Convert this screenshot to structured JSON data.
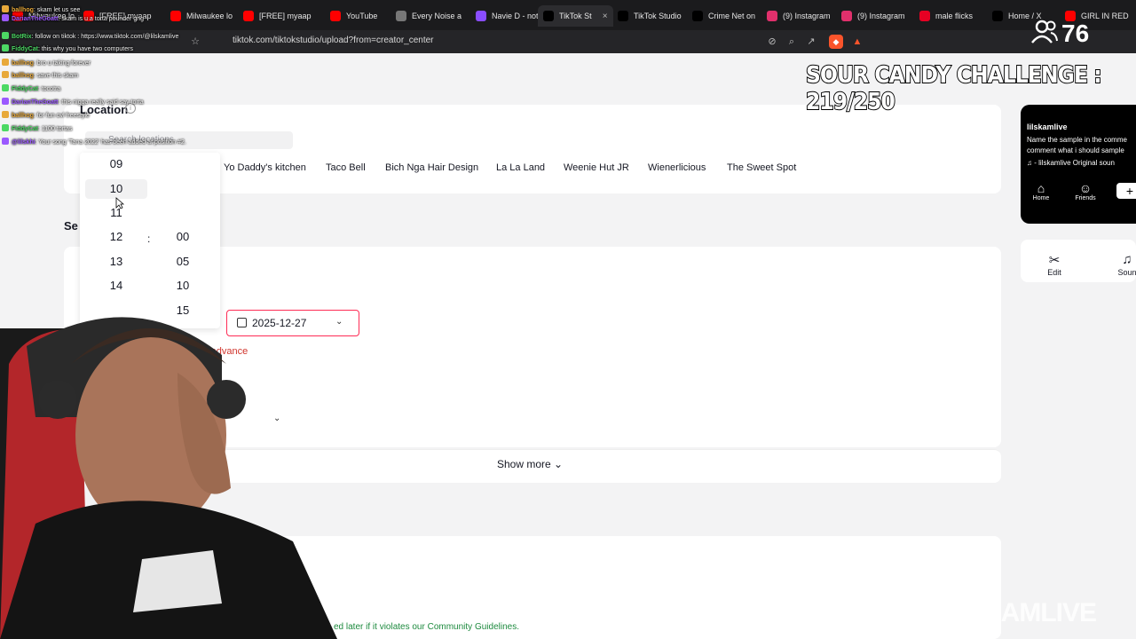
{
  "browser": {
    "tabs": [
      {
        "label": "Milwaukee lo",
        "icon": "youtube-icon",
        "color": "#ff0000"
      },
      {
        "label": "[FREE] myaap",
        "icon": "youtube-icon",
        "color": "#ff0000"
      },
      {
        "label": "Milwaukee lo",
        "icon": "youtube-icon",
        "color": "#ff0000"
      },
      {
        "label": "[FREE] myaap",
        "icon": "youtube-icon",
        "color": "#ff0000"
      },
      {
        "label": "YouTube",
        "icon": "youtube-icon",
        "color": "#ff0000"
      },
      {
        "label": "Every Noise a",
        "icon": "noise-icon",
        "color": "#777777"
      },
      {
        "label": "Navie D - noth",
        "icon": "genius-icon",
        "color": "#8a4dff"
      },
      {
        "label": "TikTok St",
        "icon": "tiktok-icon",
        "color": "#000000"
      },
      {
        "label": "TikTok Studio",
        "icon": "tiktok-icon",
        "color": "#000000"
      },
      {
        "label": "Crime Net on",
        "icon": "x-icon",
        "color": "#000000"
      },
      {
        "label": "(9) Instagram",
        "icon": "instagram-icon",
        "color": "#e1306c"
      },
      {
        "label": "(9) Instagram",
        "icon": "instagram-icon",
        "color": "#e1306c"
      },
      {
        "label": "male flicks",
        "icon": "pinterest-icon",
        "color": "#e60023"
      },
      {
        "label": "Home / X",
        "icon": "x-icon",
        "color": "#000000"
      },
      {
        "label": "GIRL IN RED",
        "icon": "youtube-icon",
        "color": "#ff0000"
      }
    ],
    "url": "tiktok.com/tiktokstudio/upload?from=creator_center"
  },
  "chat": [
    {
      "user": "ballhog",
      "msg": ": skam let us see",
      "color": "#e8a93a"
    },
    {
      "user": "DarianTheGoatt",
      "msg": ": skam is u a torta pounder gng",
      "color": "#9b59ff"
    },
    {
      "user": "BotRix",
      "msg": ": follow on tiktok : https://www.tiktok.com/@lilskamlive",
      "color": "#4cd964"
    },
    {
      "user": "FiddyCat",
      "msg": ": this why you have two computers",
      "color": "#4cd964"
    },
    {
      "user": "ballhog",
      "msg": ": bro u taking forever",
      "color": "#e8a93a"
    },
    {
      "user": "ballhog",
      "msg": ": save this skam",
      "color": "#e8a93a"
    },
    {
      "user": "FiddyCat",
      "msg": ": tocotra",
      "color": "#4cd964"
    },
    {
      "user": "DarianTheGoatt",
      "msg": ": this nigga really said say torta",
      "color": "#9b59ff"
    },
    {
      "user": "ballhog",
      "msg": ": for fun ovl freestyle",
      "color": "#e8a93a"
    },
    {
      "user": "FiddyCat",
      "msg": ": 1100 tortas",
      "color": "#4cd964"
    },
    {
      "user": "@lilskhi",
      "msg": ": Your song 'Tana 2022' has been added at position #2.",
      "color": "#9b59ff"
    }
  ],
  "stream": {
    "viewer_count": "76",
    "challenge_text": "SOUR CANDY CHALLENGE : 219/250",
    "watermark": "SKAMLIVE"
  },
  "page": {
    "location_label": "Location",
    "search_placeholder": "Search locations",
    "location_chips": [
      "Yo Daddy's kitchen",
      "Taco Bell",
      "Bich Nga Hair Design",
      "La La Land",
      "Weenie Hut JR",
      "Wienerlicious",
      "The Sweet Spot"
    ],
    "section_label_partial": "Se",
    "time_picker": {
      "hours": [
        "09",
        "10",
        "11",
        "12",
        "13",
        "14"
      ],
      "minutes": [
        "00",
        "05",
        "10",
        "15"
      ],
      "separator": ":"
    },
    "date_value": "2025-12-27",
    "advance_text": "in advance",
    "show_more": "Show more",
    "guidelines_prefix": "ed later if it violates our ",
    "guidelines_link": "Community Guidelines",
    "guidelines_suffix": "."
  },
  "preview": {
    "username": "lilskamlive",
    "description": "Name the sample in the comme comment what i should sample",
    "sound": "♫ - lilskamlive   Original soun",
    "nav": {
      "home": "Home",
      "friends": "Friends"
    },
    "tools": {
      "edit": "Edit",
      "sound": "Soun"
    }
  },
  "colors": {
    "accent": "#fe2c55",
    "error": "#d0342c",
    "link": "#1d8a3e"
  }
}
